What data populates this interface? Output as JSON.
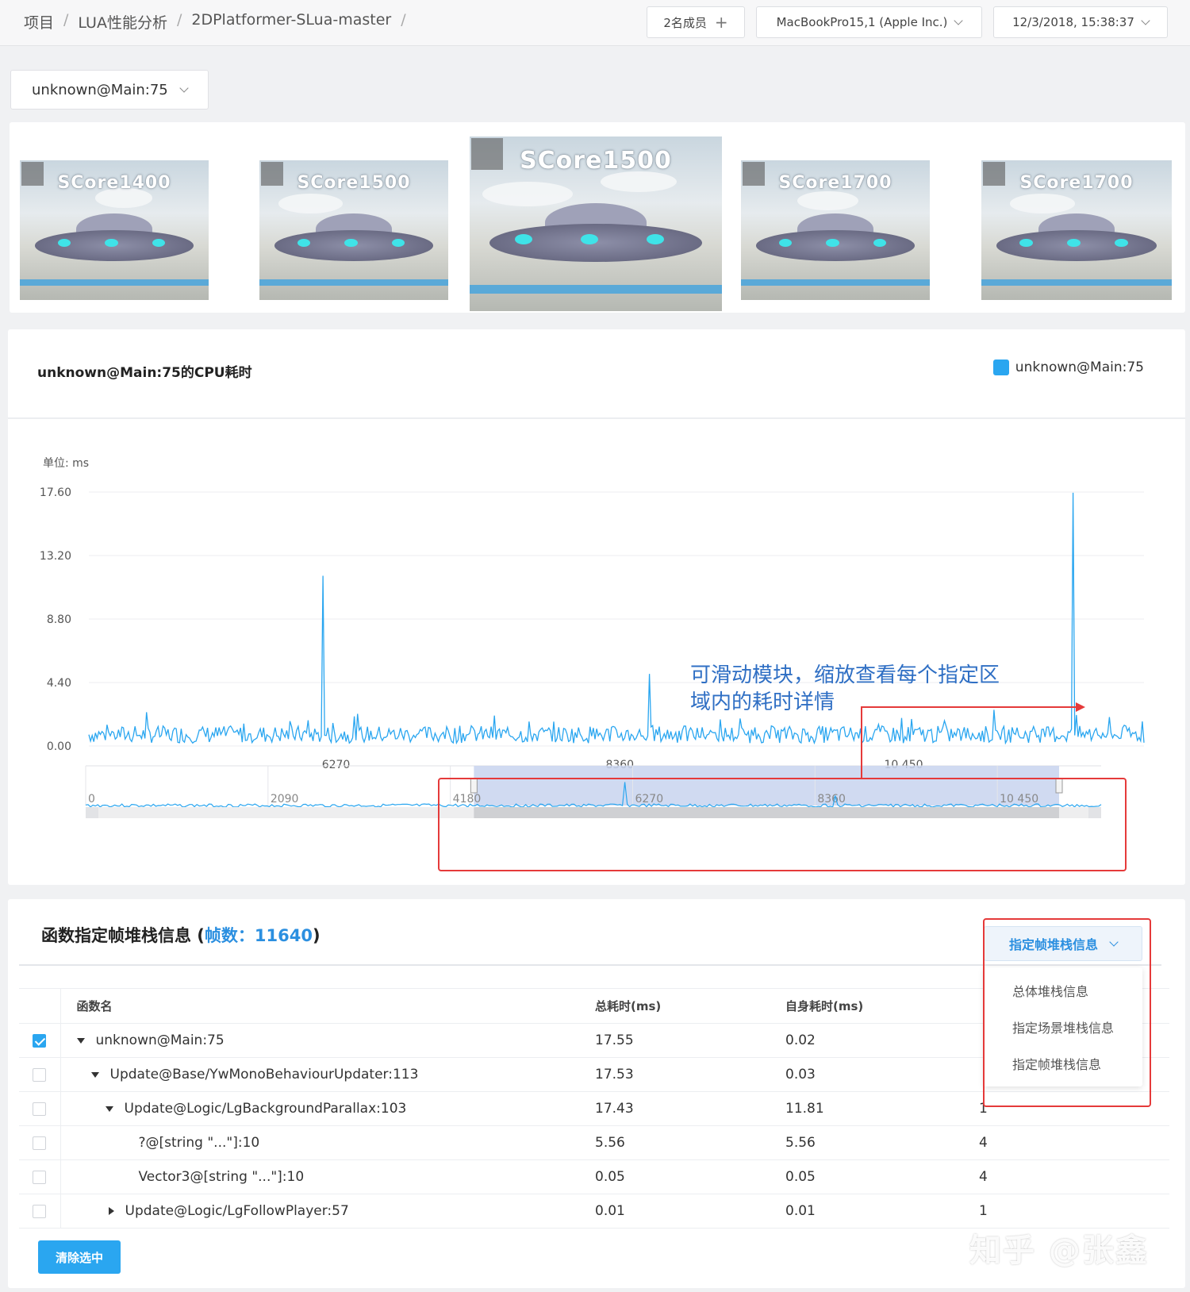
{
  "breadcrumb": [
    "项目",
    "LUA性能分析",
    "2DPlatformer-SLua-master"
  ],
  "topbar": {
    "members_label": "2名成员",
    "device_label": "MacBookPro15,1 (Apple Inc.)",
    "datetime_label": "12/3/2018, 15:38:37"
  },
  "thread_select": {
    "value": "unknown@Main:75"
  },
  "screenshots": [
    {
      "score": "SCore1400"
    },
    {
      "score": "SCore1500"
    },
    {
      "score": "SCore1500"
    },
    {
      "score": "SCore1700"
    },
    {
      "score": "SCore1700"
    }
  ],
  "cpu_chart": {
    "title": "unknown@Main:75的CPU耗时",
    "legend": "unknown@Main:75",
    "unit": "单位: ms",
    "annotation_line1": "可滑动模块，缩放查看每个指定区",
    "annotation_line2": "域内的耗时详情"
  },
  "chart_data": {
    "type": "line",
    "series": [
      {
        "name": "unknown@Main:75",
        "color": "#2aa6f0"
      }
    ],
    "ylim": [
      0,
      17.6
    ],
    "y_ticks": [
      "0.00",
      "4.40",
      "8.80",
      "13.20",
      "17.60"
    ],
    "x_visible_range": [
      4450,
      12220
    ],
    "x_ticks": [
      "6270",
      "8360",
      "10 450"
    ],
    "baseline_range": [
      0.2,
      1.4
    ],
    "peaks": [
      {
        "x": 6180,
        "y": 11.8
      },
      {
        "x": 8580,
        "y": 5.0
      },
      {
        "x": 11700,
        "y": 17.55
      }
    ],
    "navigator": {
      "range": [
        0,
        11640
      ],
      "ticks": [
        "0",
        "2090",
        "4180",
        "6270",
        "8360",
        "10 450"
      ],
      "selected_range": [
        4450,
        12220
      ]
    }
  },
  "stack": {
    "title": "函数指定帧堆栈信息 (",
    "frames_label": "帧数：",
    "frames_value": "11640",
    "title_close": ")",
    "view_select": "指定帧堆栈信息",
    "menu": [
      "总体堆栈信息",
      "指定场景堆栈信息",
      "指定帧堆栈信息"
    ],
    "columns": [
      "函数名",
      "总耗时(ms)",
      "自身耗时(ms)",
      ""
    ],
    "rows": [
      {
        "name": "unknown@Main:75",
        "total": "17.55",
        "self": "0.02",
        "calls": "",
        "checked": true
      },
      {
        "name": "Update@Base/YwMonoBehaviourUpdater:113",
        "total": "17.53",
        "self": "0.03",
        "calls": "",
        "checked": false
      },
      {
        "name": "Update@Logic/LgBackgroundParallax:103",
        "total": "17.43",
        "self": "11.81",
        "calls": "1",
        "checked": false
      },
      {
        "name": "?@[string \"...\"]:10",
        "total": "5.56",
        "self": "5.56",
        "calls": "4",
        "checked": false
      },
      {
        "name": "Vector3@[string \"...\"]:10",
        "total": "0.05",
        "self": "0.05",
        "calls": "4",
        "checked": false
      },
      {
        "name": "Update@Logic/LgFollowPlayer:57",
        "total": "0.01",
        "self": "0.01",
        "calls": "1",
        "checked": false
      }
    ],
    "clear_button": "清除选中"
  },
  "watermark": "知乎 @张鑫"
}
